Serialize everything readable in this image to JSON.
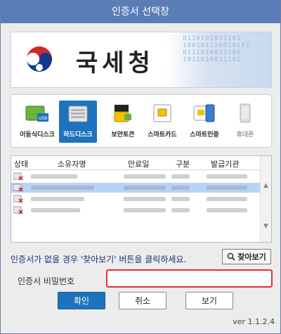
{
  "window": {
    "title": "인증서 선택창"
  },
  "banner": {
    "org_name": "국세청",
    "bits": "0110101011101\n100101110010101\n0111010011100\n1011010011101",
    "emblem_icon": "taegeuk-emblem-icon"
  },
  "storage": {
    "items": [
      {
        "label": "이동식디스크",
        "icon": "usb-drive-icon",
        "state": "normal"
      },
      {
        "label": "하드디스크",
        "icon": "hard-disk-icon",
        "state": "selected"
      },
      {
        "label": "보안토큰",
        "icon": "security-token-icon",
        "state": "normal"
      },
      {
        "label": "스마트카드",
        "icon": "smart-card-icon",
        "state": "normal"
      },
      {
        "label": "스마트인증",
        "icon": "smart-auth-icon",
        "state": "normal"
      },
      {
        "label": "휴대폰",
        "icon": "mobile-phone-icon",
        "state": "disabled"
      }
    ]
  },
  "table": {
    "headers": {
      "status": "상태",
      "owner": "소유자명",
      "expiry": "만료일",
      "type": "구분",
      "issuer": "발급기관"
    },
    "status_icon": "expired-certificate-icon"
  },
  "hint": "인증서가 없을 경우 '찾아보기' 버튼을 클릭하세요.",
  "find_button": {
    "label": "찾아보기",
    "icon": "magnifier-icon"
  },
  "password": {
    "label": "인증서 비밀번호",
    "value": "",
    "placeholder": ""
  },
  "buttons": {
    "confirm": "확인",
    "cancel": "취소",
    "view": "보기"
  },
  "version": "ver 1.1.2.4",
  "colors": {
    "title_bar": "#5a7db7",
    "accent": "#1e73be",
    "selected_row": "#b7d4f7",
    "password_border": "#e0313a",
    "hint_text": "#17317a"
  }
}
